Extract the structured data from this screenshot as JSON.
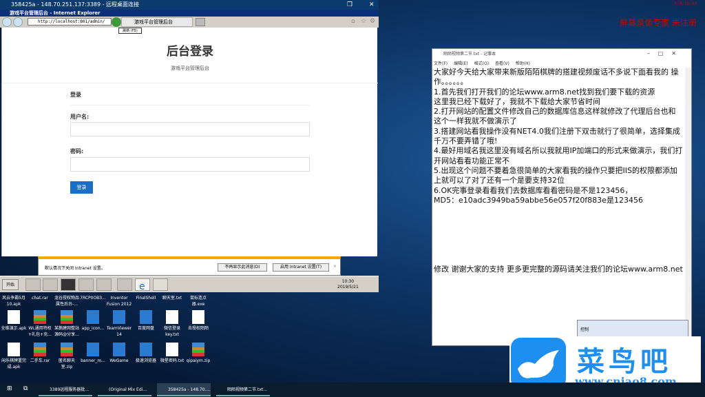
{
  "rdp": {
    "title": "358425a - 148.70.251.137:3389 - 远程桌面连接",
    "restore": "❐",
    "close": "✕"
  },
  "ie": {
    "title": "游戏平台管理后台 - Internet Explorer",
    "address": "http://localhost:801/admin/",
    "tab": "游戏平台管理后台",
    "tooltip": "刷新 (F5)"
  },
  "page": {
    "title": "后台登录",
    "subtitle": "游戏平台管理后台",
    "section": "登录",
    "username_label": "用户名:",
    "username_value": "",
    "password_label": "密码:",
    "password_value": "",
    "login_button": "登录"
  },
  "infobar": {
    "message": "默认情况下关闭 Intranet 设置。",
    "dont_show": "不再显示此消息(D)",
    "enable": "启用 Intranet 设置(T)",
    "close": "×"
  },
  "xp_taskbar": {
    "start": "开始",
    "time": "10:30",
    "date": "2019/5/21"
  },
  "desktop_icons": [
    {
      "label": "风云争霸5月10.apk",
      "type": "file"
    },
    {
      "label": "chat.rar",
      "type": "rar"
    },
    {
      "label": "龙谷授权物品属性后台-...",
      "type": "rar"
    },
    {
      "label": "7RCP0OB3...",
      "type": "file"
    },
    {
      "label": "Inventor Fusion 2012",
      "type": "app"
    },
    {
      "label": "FinalShell",
      "type": "app"
    },
    {
      "label": "聊天室.txt",
      "type": "file"
    },
    {
      "label": "鼠标连点器.exe",
      "type": "file"
    },
    {
      "label": "全维演示.apk",
      "type": "file"
    },
    {
      "label": "WL通用特权+礼包+充...",
      "type": "rar"
    },
    {
      "label": "某鹅建网整站源码@分享...",
      "type": "rar"
    },
    {
      "label": "app_icon...",
      "type": "app"
    },
    {
      "label": "TeamViewer 14",
      "type": "app"
    },
    {
      "label": "百度网盘",
      "type": "app"
    },
    {
      "label": "微信登录key.txt",
      "type": "file"
    },
    {
      "label": "去授权陌陌",
      "type": "file"
    },
    {
      "label": "闲乐棋牌重完成.apk",
      "type": "file"
    },
    {
      "label": "二手车.rar",
      "type": "rar"
    },
    {
      "label": "匿名聊天室.zip",
      "type": "rar"
    },
    {
      "label": "banner_m...",
      "type": "app"
    },
    {
      "label": "WeGame",
      "type": "app"
    },
    {
      "label": "极速浏览器",
      "type": "app"
    },
    {
      "label": "微星密码.txt",
      "type": "file"
    },
    {
      "label": "qipaiym.zip",
      "type": "rar"
    }
  ],
  "notepad": {
    "title": "陌陌视频第二节.txt - 记事本",
    "menu": [
      "文件(F)",
      "编辑(E)",
      "格式(O)",
      "查看(V)",
      "帮助(H)"
    ],
    "lines": [
      "大家好今天给大家带来新版陌陌棋牌的搭建视频废话不多说下面看我的 操作。。。。。。",
      "1.首先我们打开我们的论坛www.arm8.net找到我们要下载的资源",
      "这里我已经下载好了，我就不下载给大家节省时间",
      "2.打开网站的配置文件修改自己的数据库信息这样就修改了代理后台也和这个一样我就不做演示了",
      "3.搭建网站看我操作没有NET4.0我们注册下双击就行了很简单，选择集成千万不要弄错了哦!",
      "4.最好用域名我这里没有域名所以我就用IP加端口的形式来做演示，我们打开网站看看功能正常不",
      "5.出现这个问题不要着急很简单的大家看我的操作只要把IIS的权限都添加上就可以了对了还有一个是要支持32位",
      "6.OK完事登录看看我们去数据库看看密码是不是123456，",
      "MD5：e10adc3949ba59abbe56e057f20f883e是123456"
    ],
    "footer": "修改 谢谢大家的支持 更多更完整的源码请关注我们的论坛www.arm8.net"
  },
  "control_window": {
    "title": "控制"
  },
  "watermark": {
    "cn": "菜鸟吧",
    "url": "www.cniao8.com"
  },
  "recorder": {
    "text": "屏幕录像专家 未注册",
    "time": "5:9/16:43"
  },
  "win10_taskbar": {
    "items": [
      "3389远程服务器批...",
      "(Original Mix Edi...",
      "358425a - 148.70....",
      "陌陌视频第二节.txt..."
    ]
  },
  "colors": {
    "accent": "#1a6fc4",
    "watermark": "#1e8ff0",
    "infobar": "#f2a900"
  }
}
